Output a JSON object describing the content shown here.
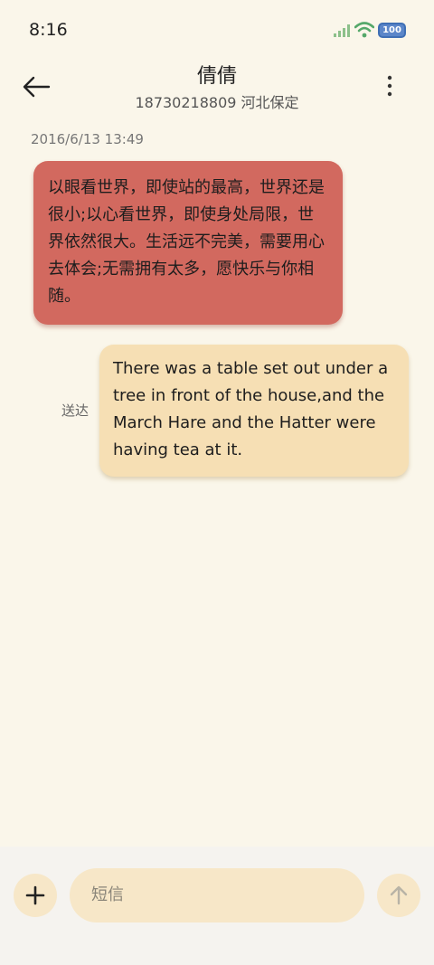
{
  "status_bar": {
    "time": "8:16",
    "battery": "100",
    "icons": [
      "signal-icon",
      "wifi-icon",
      "battery-icon"
    ]
  },
  "header": {
    "back_icon": "arrow-left-icon",
    "contact_name": "倩倩",
    "contact_subtitle": "18730218809 河北保定",
    "more_icon": "more-vertical-icon"
  },
  "conversation": {
    "timestamp": "2016/6/13 13:49",
    "messages": [
      {
        "direction": "incoming",
        "text": "以眼看世界，即使站的最高，世界还是很小;以心看世界，即使身处局限，世界依然很大。生活远不完美，需要用心去体会;无需拥有太多，愿快乐与你相随。"
      },
      {
        "direction": "outgoing",
        "text": "There was a table set out under a tree in front of the house,and the March Hare and the Hatter were having tea at it.",
        "status": "送达"
      }
    ]
  },
  "composer": {
    "add_icon": "plus-icon",
    "placeholder": "短信",
    "send_icon": "arrow-up-icon"
  },
  "colors": {
    "background": "#faf6ea",
    "incoming_bubble": "#d2695f",
    "outgoing_bubble": "#f6dfb4",
    "input_background": "#f7e7c8"
  }
}
